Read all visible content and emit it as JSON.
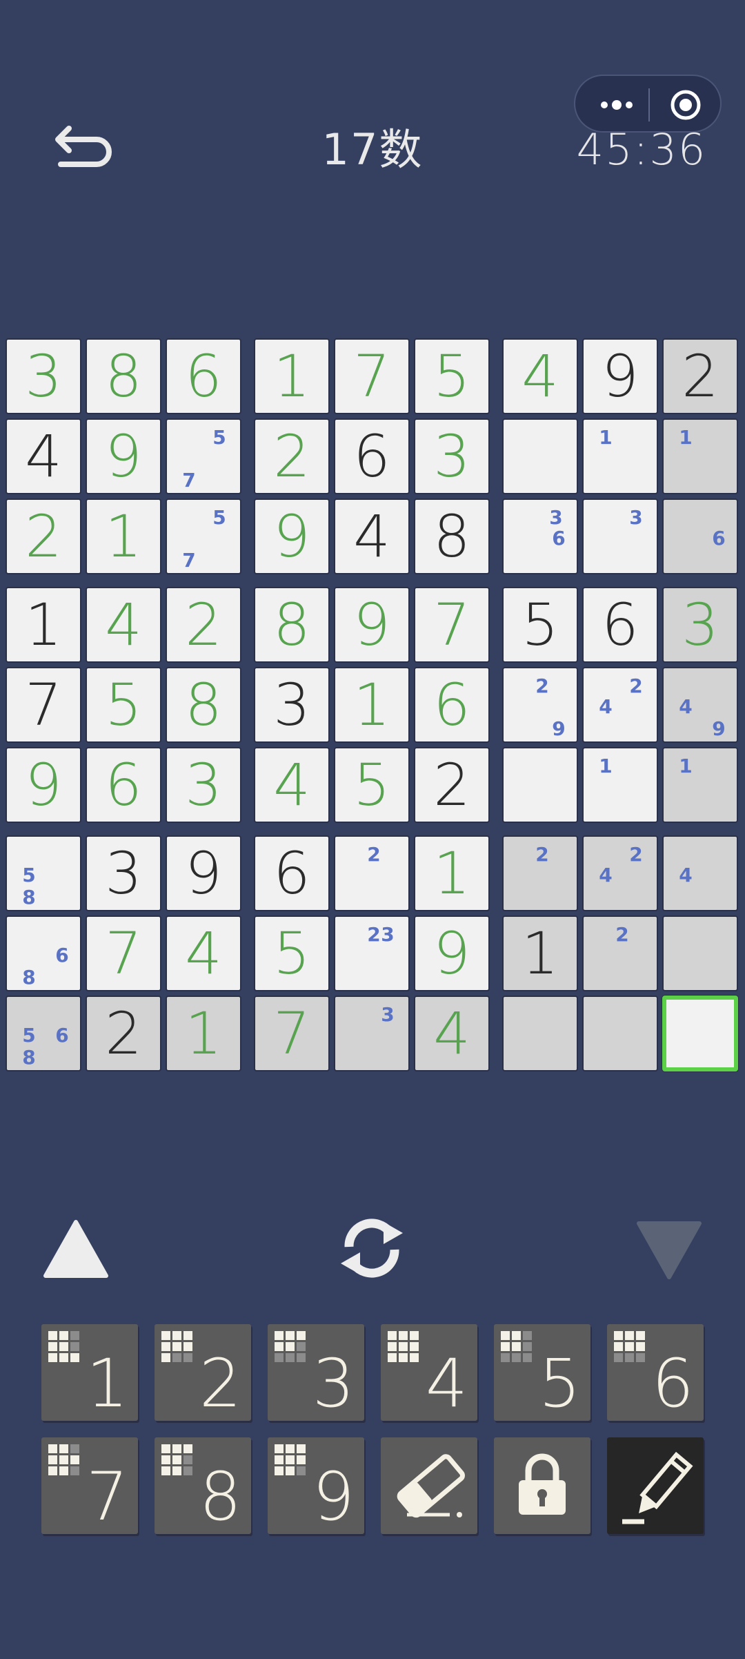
{
  "header": {
    "title": "17数",
    "timer": "45:36",
    "back_icon": "back-arrow-icon",
    "menu_icon": "more-dots-icon",
    "record_icon": "target-icon"
  },
  "board": {
    "given_color": "#2b2b2b",
    "entered_color": "#58a34f",
    "note_color": "#5a72c4",
    "selected_cell": [
      8,
      8
    ],
    "cells": [
      [
        {
          "v": "3",
          "t": "entered"
        },
        {
          "v": "8",
          "t": "entered"
        },
        {
          "v": "6",
          "t": "entered"
        },
        {
          "v": "1",
          "t": "entered"
        },
        {
          "v": "7",
          "t": "entered"
        },
        {
          "v": "5",
          "t": "entered"
        },
        {
          "v": "4",
          "t": "entered"
        },
        {
          "v": "9",
          "t": "given"
        },
        {
          "v": "2",
          "t": "given",
          "shade": true
        }
      ],
      [
        {
          "v": "4",
          "t": "given"
        },
        {
          "v": "9",
          "t": "entered"
        },
        {
          "notes": [
            "5",
            "7"
          ],
          "pos": [
            "tr",
            "bl"
          ]
        },
        {
          "v": "2",
          "t": "entered"
        },
        {
          "v": "6",
          "t": "given"
        },
        {
          "v": "3",
          "t": "entered"
        },
        {
          "v": ""
        },
        {
          "notes": [
            "1"
          ],
          "pos": [
            "tl"
          ]
        },
        {
          "notes": [
            "1"
          ],
          "pos": [
            "tl"
          ],
          "shade": true
        }
      ],
      [
        {
          "v": "2",
          "t": "entered"
        },
        {
          "v": "1",
          "t": "entered"
        },
        {
          "notes": [
            "5",
            "7"
          ],
          "pos": [
            "tr",
            "bl"
          ]
        },
        {
          "v": "9",
          "t": "entered"
        },
        {
          "v": "4",
          "t": "given"
        },
        {
          "v": "8",
          "t": "given"
        },
        {
          "notes": [
            "3",
            "6"
          ],
          "pos": [
            "tr",
            "mr"
          ]
        },
        {
          "notes": [
            "3"
          ],
          "pos": [
            "tr"
          ]
        },
        {
          "notes": [
            "6"
          ],
          "pos": [
            "mr"
          ],
          "shade": true
        }
      ],
      [
        {
          "v": "1",
          "t": "given"
        },
        {
          "v": "4",
          "t": "entered"
        },
        {
          "v": "2",
          "t": "entered"
        },
        {
          "v": "8",
          "t": "entered"
        },
        {
          "v": "9",
          "t": "entered"
        },
        {
          "v": "7",
          "t": "entered"
        },
        {
          "v": "5",
          "t": "given"
        },
        {
          "v": "6",
          "t": "given"
        },
        {
          "v": "3",
          "t": "entered",
          "shade": true
        }
      ],
      [
        {
          "v": "7",
          "t": "given"
        },
        {
          "v": "5",
          "t": "entered"
        },
        {
          "v": "8",
          "t": "entered"
        },
        {
          "v": "3",
          "t": "given"
        },
        {
          "v": "1",
          "t": "entered"
        },
        {
          "v": "6",
          "t": "entered"
        },
        {
          "notes": [
            "2",
            "9"
          ],
          "pos": [
            "tc",
            "br"
          ]
        },
        {
          "notes": [
            "2",
            "4"
          ],
          "pos": [
            "tr",
            "ml"
          ]
        },
        {
          "notes": [
            "4",
            "9"
          ],
          "pos": [
            "ml",
            "br"
          ],
          "shade": true
        }
      ],
      [
        {
          "v": "9",
          "t": "entered"
        },
        {
          "v": "6",
          "t": "entered"
        },
        {
          "v": "3",
          "t": "entered"
        },
        {
          "v": "4",
          "t": "entered"
        },
        {
          "v": "5",
          "t": "entered"
        },
        {
          "v": "2",
          "t": "given"
        },
        {
          "v": ""
        },
        {
          "notes": [
            "1"
          ],
          "pos": [
            "tl"
          ]
        },
        {
          "notes": [
            "1"
          ],
          "pos": [
            "tl"
          ],
          "shade": true
        }
      ],
      [
        {
          "notes": [
            "5",
            "8"
          ],
          "pos": [
            "ml",
            "bl"
          ]
        },
        {
          "v": "3",
          "t": "given"
        },
        {
          "v": "9",
          "t": "given"
        },
        {
          "v": "6",
          "t": "given"
        },
        {
          "notes": [
            "2"
          ],
          "pos": [
            "tc"
          ]
        },
        {
          "v": "1",
          "t": "entered"
        },
        {
          "notes": [
            "2"
          ],
          "pos": [
            "tc"
          ],
          "shade": true
        },
        {
          "notes": [
            "2",
            "4"
          ],
          "pos": [
            "tr",
            "ml"
          ],
          "shade": true
        },
        {
          "notes": [
            "4"
          ],
          "pos": [
            "ml"
          ],
          "shade": true
        }
      ],
      [
        {
          "notes": [
            "6",
            "8"
          ],
          "pos": [
            "mr",
            "bl"
          ]
        },
        {
          "v": "7",
          "t": "entered"
        },
        {
          "v": "4",
          "t": "entered"
        },
        {
          "v": "5",
          "t": "entered"
        },
        {
          "notes": [
            "2",
            "3"
          ],
          "pos": [
            "tc",
            "tr"
          ]
        },
        {
          "v": "9",
          "t": "entered"
        },
        {
          "v": "1",
          "t": "given",
          "shade": true
        },
        {
          "notes": [
            "2"
          ],
          "pos": [
            "tc"
          ],
          "shade": true
        },
        {
          "v": "",
          "shade": true
        }
      ],
      [
        {
          "notes": [
            "5",
            "6",
            "8"
          ],
          "pos": [
            "ml",
            "mr",
            "bl"
          ],
          "shade": true
        },
        {
          "v": "2",
          "t": "given",
          "shade": true
        },
        {
          "v": "1",
          "t": "entered",
          "shade": true
        },
        {
          "v": "7",
          "t": "entered",
          "shade": true
        },
        {
          "notes": [
            "3"
          ],
          "pos": [
            "tr"
          ],
          "shade": true
        },
        {
          "v": "4",
          "t": "entered",
          "shade": true
        },
        {
          "v": "",
          "shade": true
        },
        {
          "v": "",
          "shade": true
        },
        {
          "v": "",
          "selected": true
        }
      ]
    ]
  },
  "controls": {
    "up_icon": "triangle-up-icon",
    "rotate_icon": "sync-icon",
    "down_icon": "triangle-down-icon"
  },
  "keypad": {
    "numbers": [
      "1",
      "2",
      "3",
      "4",
      "5",
      "6",
      "7",
      "8",
      "9"
    ],
    "erase_icon": "eraser-icon",
    "lock_icon": "lock-icon",
    "pencil_icon": "pencil-icon"
  }
}
